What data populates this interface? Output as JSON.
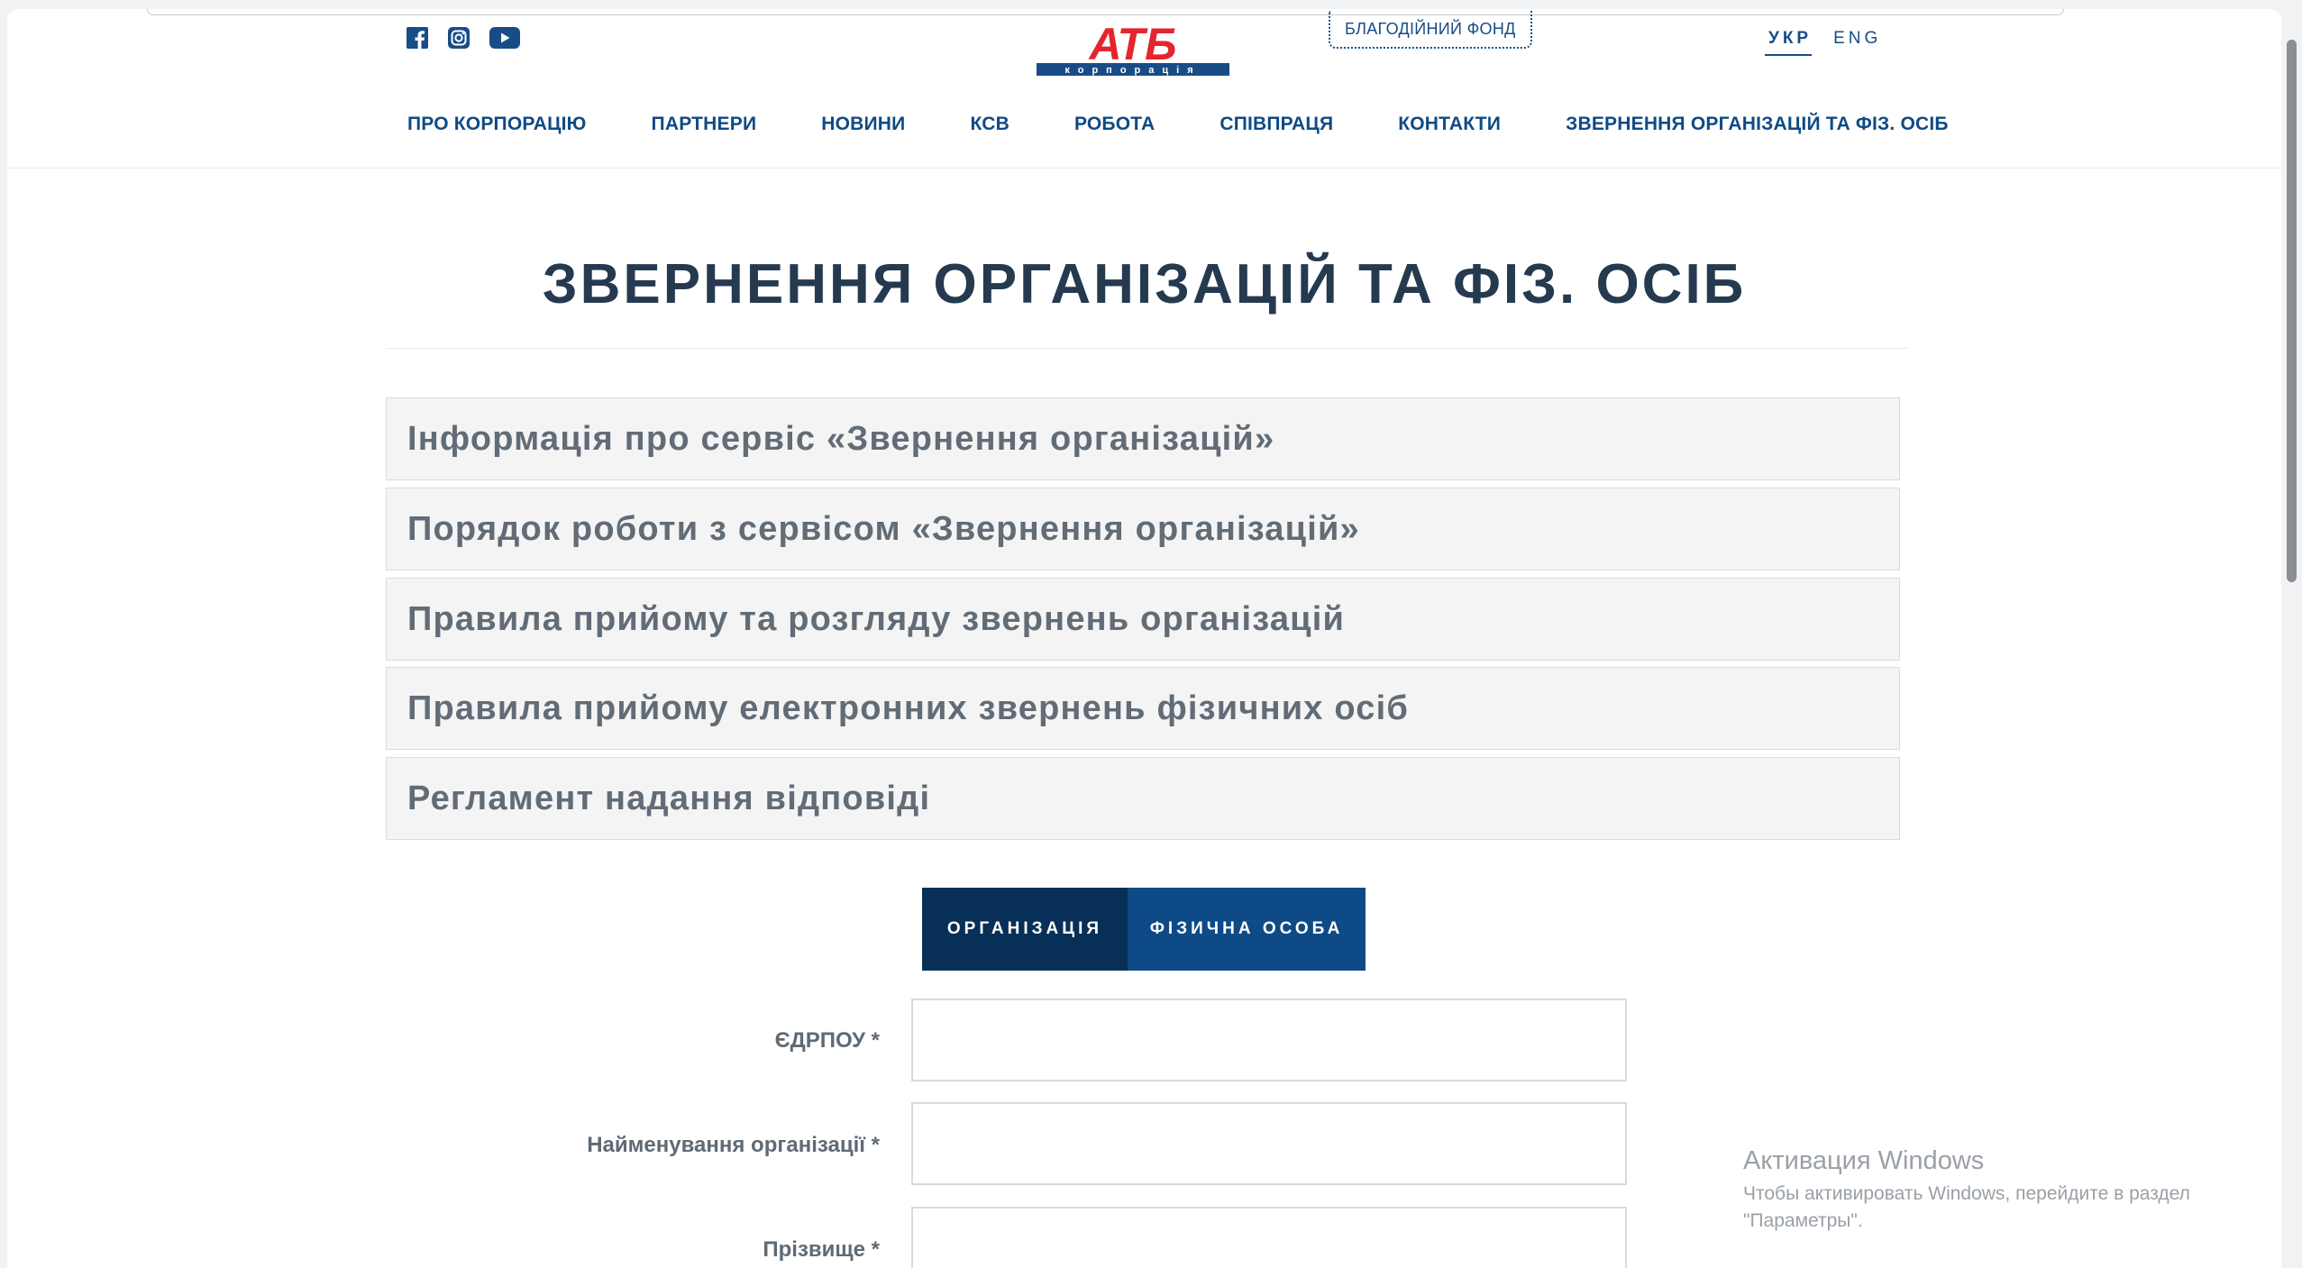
{
  "header": {
    "social": [
      "facebook-icon",
      "instagram-icon",
      "youtube-icon"
    ],
    "logo_text": "АТБ",
    "logo_sub": "корпорація",
    "charity_label": "БЛАГОДІЙНИЙ ФОНД",
    "lang": [
      {
        "label": "УКР",
        "active": true
      },
      {
        "label": "ENG",
        "active": false
      }
    ],
    "nav": [
      "ПРО КОРПОРАЦІЮ",
      "ПАРТНЕРИ",
      "НОВИНИ",
      "КСВ",
      "РОБОТА",
      "СПІВПРАЦЯ",
      "КОНТАКТИ",
      "ЗВЕРНЕННЯ ОРГАНІЗАЦІЙ ТА ФІЗ. ОСІБ"
    ]
  },
  "page_title": "ЗВЕРНЕННЯ ОРГАНІЗАЦІЙ ТА ФІЗ. ОСІБ",
  "accordion": [
    "Інформація про сервіс «Звернення організацій»",
    "Порядок роботи з сервісом «Звернення організацій»",
    "Правила прийому та розгляду звернень організацій",
    "Правила прийому електронних звернень фізичних осіб",
    "Регламент надання відповіді"
  ],
  "tabs": {
    "organization": "ОРГАНІЗАЦІЯ",
    "person": "ФІЗИЧНА ОСОБА",
    "active": "organization"
  },
  "form": {
    "fields": [
      {
        "label": "ЄДРПОУ *",
        "value": ""
      },
      {
        "label": "Найменування організації *",
        "value": ""
      },
      {
        "label": "Прізвище *",
        "value": ""
      }
    ]
  },
  "windows_watermark": {
    "title": "Активация Windows",
    "line1": "Чтобы активировать Windows, перейдите в раздел",
    "line2": "\"Параметры\"."
  },
  "colors": {
    "brand_red": "#e3262d",
    "brand_blue": "#0e4a86",
    "dark_blue": "#082f57"
  }
}
